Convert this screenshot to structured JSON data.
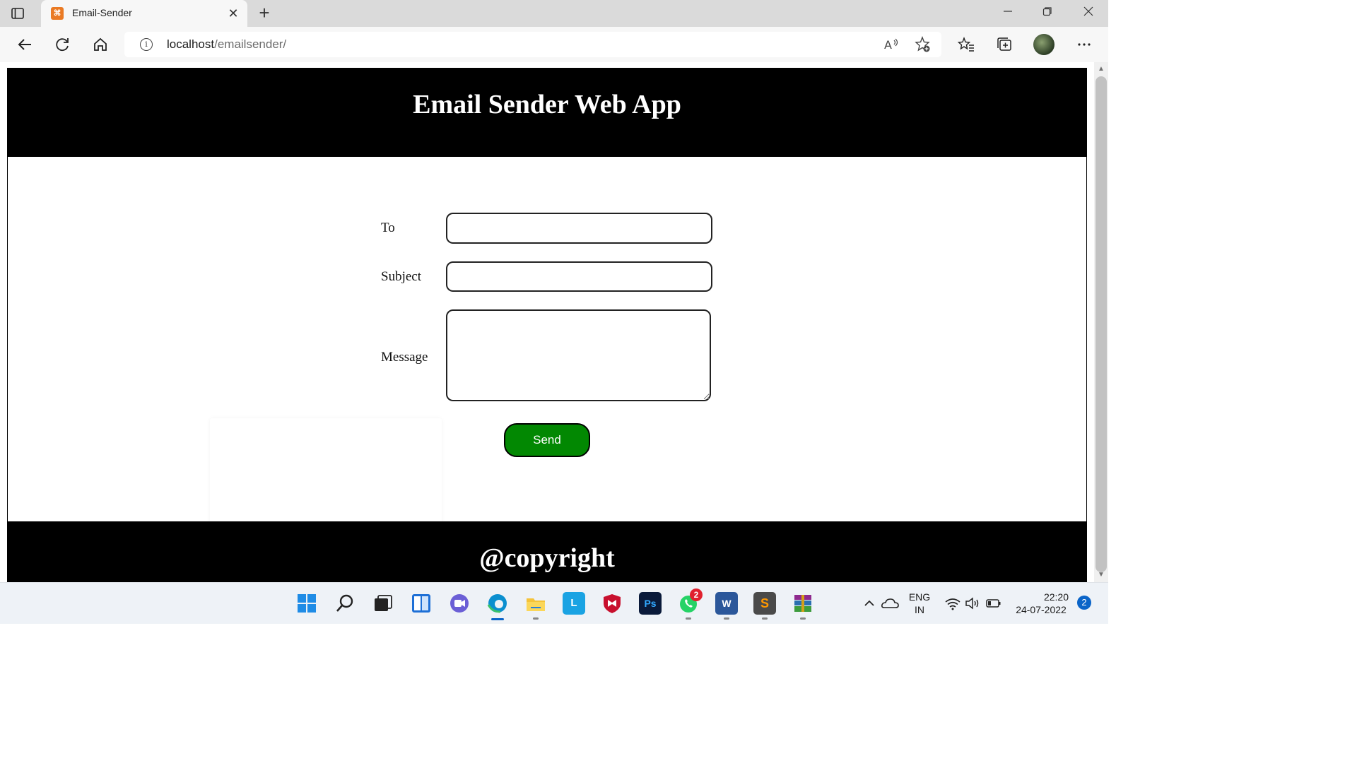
{
  "browser": {
    "tab_title": "Email-Sender",
    "address": {
      "host": "localhost",
      "path": "/emailsender/"
    }
  },
  "page": {
    "header_title": "Email Sender Web App",
    "form": {
      "to_label": "To",
      "to_value": "",
      "subject_label": "Subject",
      "subject_value": "",
      "message_label": "Message",
      "message_value": "",
      "send_label": "Send"
    },
    "footer_text": "@copyright"
  },
  "taskbar": {
    "whatsapp_badge": "2",
    "language": {
      "line1": "ENG",
      "line2": "IN"
    },
    "clock": {
      "time": "22:20",
      "date": "24-07-2022"
    },
    "notification_count": "2"
  },
  "colors": {
    "header_bg": "#000000",
    "send_button": "#028802",
    "tab_favicon": "#ea7a24"
  },
  "icons": [
    "tab-actions-icon",
    "favicon-icon",
    "close-icon",
    "plus-icon",
    "minimize-icon",
    "restore-icon",
    "window-close-icon",
    "back-icon",
    "refresh-icon",
    "home-icon",
    "info-icon",
    "read-aloud-icon",
    "add-favorite-icon",
    "favorites-icon",
    "collections-icon",
    "more-icon",
    "windows-start-icon",
    "search-icon",
    "task-view-icon",
    "widgets-icon",
    "chat-icon",
    "edge-icon",
    "file-explorer-icon",
    "l-app-icon",
    "mcafee-icon",
    "photoshop-icon",
    "whatsapp-icon",
    "word-icon",
    "sublime-icon",
    "winrar-icon",
    "chevron-up-icon",
    "onedrive-icon",
    "wifi-icon",
    "volume-icon",
    "battery-icon"
  ]
}
